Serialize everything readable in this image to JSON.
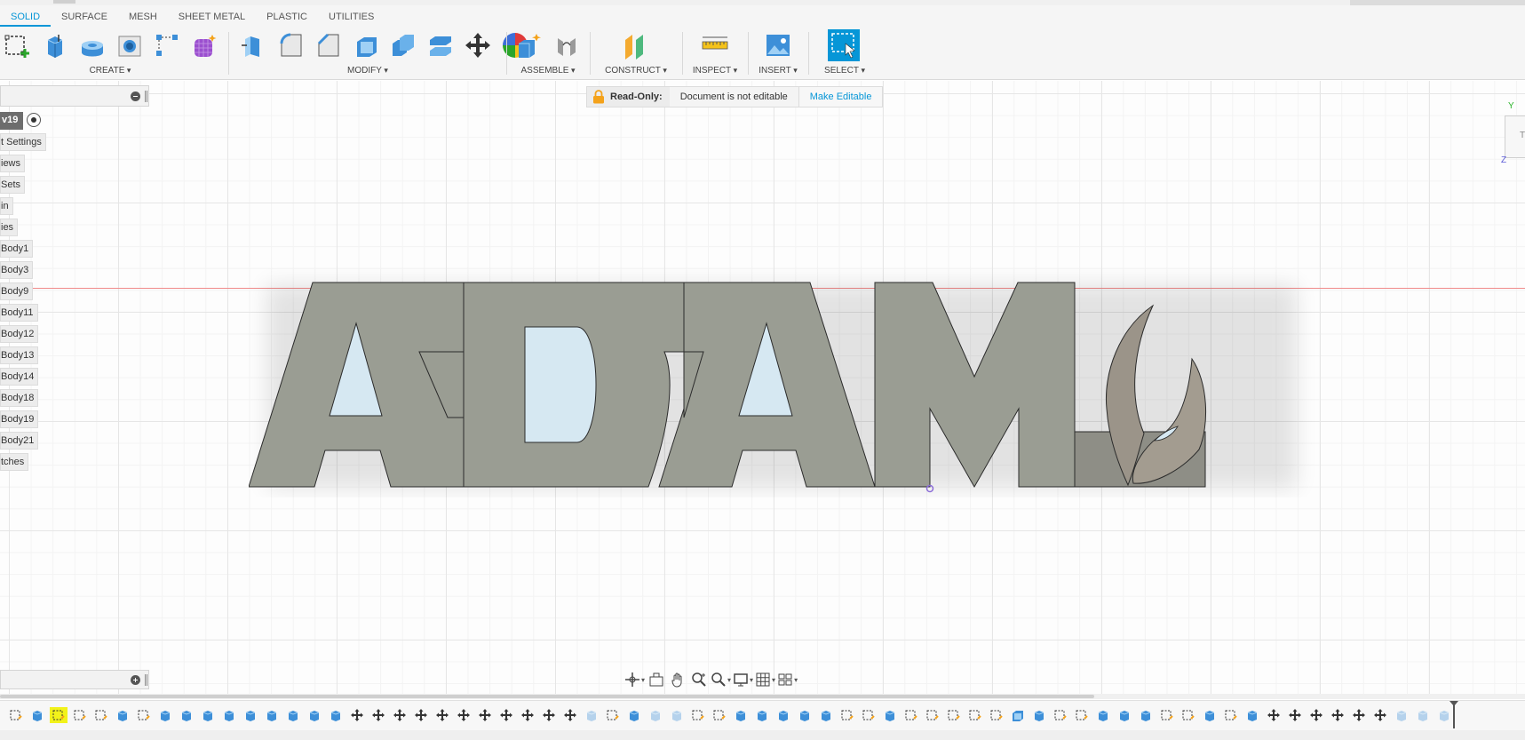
{
  "tabs": [
    {
      "label": "SOLID",
      "active": true
    },
    {
      "label": "SURFACE",
      "active": false
    },
    {
      "label": "MESH",
      "active": false
    },
    {
      "label": "SHEET METAL",
      "active": false
    },
    {
      "label": "PLASTIC",
      "active": false
    },
    {
      "label": "UTILITIES",
      "active": false
    }
  ],
  "toolbar": {
    "create": {
      "label": "CREATE",
      "icons": [
        "create-sketch-icon",
        "extrude-icon",
        "revolve-icon",
        "hole-icon",
        "pattern-icon",
        "form-icon"
      ]
    },
    "modify": {
      "label": "MODIFY",
      "icons": [
        "press-pull-icon",
        "fillet-icon",
        "chamfer-icon",
        "shell-icon",
        "combine-icon",
        "move-icon",
        "appearance-icon"
      ]
    },
    "assemble": {
      "label": "ASSEMBLE",
      "icons": [
        "new-component-icon",
        "joint-icon"
      ]
    },
    "construct": {
      "label": "CONSTRUCT",
      "icons": [
        "offset-plane-icon"
      ]
    },
    "inspect": {
      "label": "INSPECT",
      "icons": [
        "measure-icon"
      ]
    },
    "insert": {
      "label": "INSERT",
      "icons": [
        "insert-image-icon"
      ]
    },
    "select": {
      "label": "SELECT",
      "icons": [
        "select-icon"
      ]
    }
  },
  "browser": {
    "version": "v19",
    "items": [
      "t Settings",
      "iews",
      "Sets",
      "in",
      "ies",
      "Body1",
      "Body3",
      "Body9",
      "Body11",
      "Body12",
      "Body13",
      "Body14",
      "Body18",
      "Body19",
      "Body21",
      "tches"
    ]
  },
  "banner": {
    "readonly_label": "Read-Only:",
    "message": "Document is not editable",
    "action": "Make Editable"
  },
  "viewcube": {
    "face": "T",
    "axis_y": "Y",
    "axis_z": "Z"
  },
  "colors": {
    "accent": "#0696d7",
    "model_gray": "#9a9d93",
    "glass": "#d6e8f2",
    "axis_red": "#f08a8a"
  },
  "timeline_count": 68,
  "timeline_selected_index": 2
}
